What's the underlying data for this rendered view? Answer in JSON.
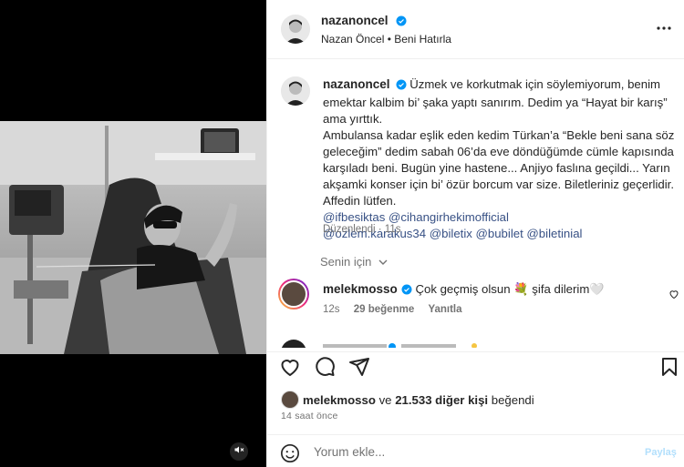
{
  "post": {
    "author": "nazanoncel",
    "audio_line": "Nazan Öncel • Beni Hatırla",
    "caption_lines": [
      "Üzmek ve korkutmak için söylemiyorum, benim",
      "emektar kalbim bi’ şaka yaptı sanırım. Dedim ya “Hayat bir karış”",
      "ama yırttık.",
      "Ambulansa kadar eşlik eden kedim Türkan’a “Bekle beni sana söz",
      "geleceğim” dedim sabah 06’da eve döndüğümde cümle kapısında",
      "karşıladı beni. Bugün yine hastene... Anjiyo faslına geçildi... Yarın",
      "akşamki konser için bi’ özür borcum var size. Biletleriniz geçerlidir.",
      "Affedin lütfen."
    ],
    "mentions_line1": "@ifbesiktas @cihangirhekimofficial",
    "mentions_line2": "@ozlem.karakus34 @biletix @bubilet @biletinial",
    "edited": "Düzenlendi",
    "edited_time": "11s",
    "for_you": "Senin için"
  },
  "comment": {
    "author": "melekmosso",
    "text": "Çok geçmiş olsun 💐 şifa dilerim🤍",
    "time": "12s",
    "likes": "29 beğenme",
    "reply": "Yanıtla"
  },
  "likes": {
    "user": "melekmosso",
    "connector": "ve",
    "others": "21.533 diğer kişi",
    "suffix": "beğendi"
  },
  "time_ago": "14 saat önce",
  "comment_box": {
    "placeholder": "Yorum ekle...",
    "post_label": "Paylaş"
  },
  "colors": {
    "verified": "#0095f6",
    "mention": "#385185",
    "muted": "#737373"
  },
  "icons": [
    "verified-badge-icon",
    "more-options-icon",
    "heart-icon",
    "comment-icon",
    "share-icon",
    "bookmark-icon",
    "emoji-icon",
    "mute-icon"
  ]
}
